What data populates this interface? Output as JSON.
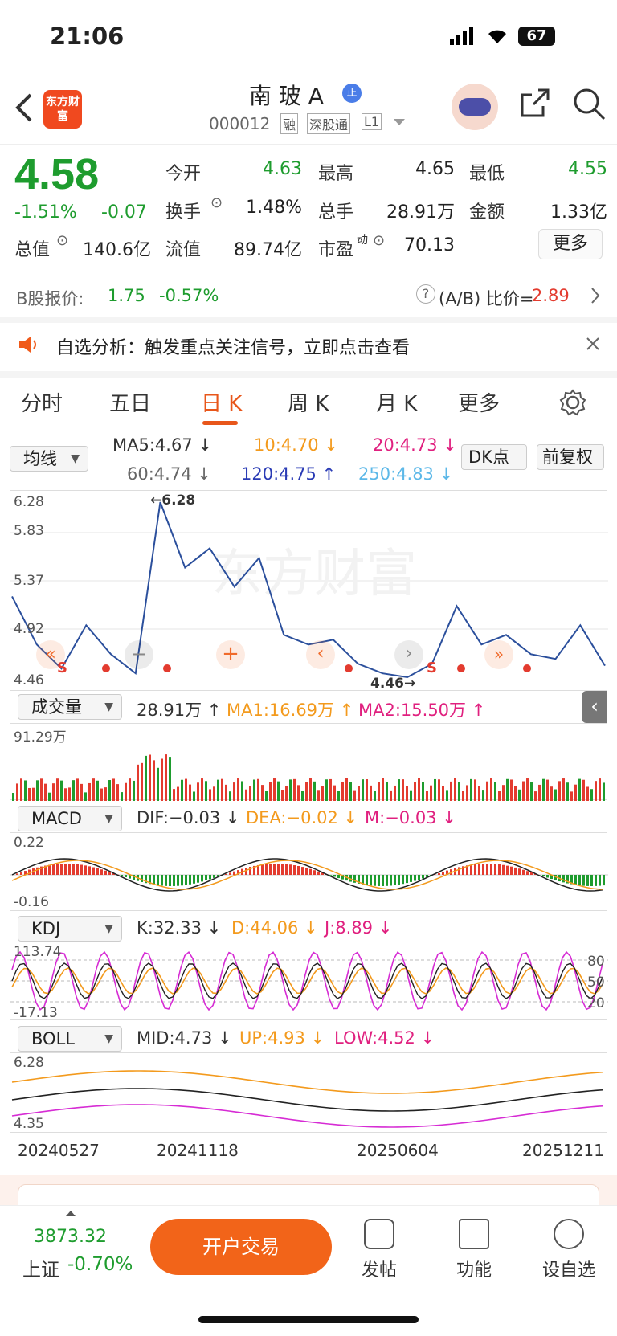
{
  "status": {
    "time": "21:06",
    "battery": "67"
  },
  "header": {
    "logo_text": "东方财富",
    "stock_name": "南 玻 A",
    "badge": "正",
    "code": "000012",
    "tags": [
      "融",
      "深股通",
      "L1"
    ]
  },
  "quote": {
    "price": "4.58",
    "change_pct": "-1.51%",
    "change": "-0.07",
    "open_label": "今开",
    "open": "4.63",
    "high_label": "最高",
    "high": "4.65",
    "low_label": "最低",
    "low": "4.55",
    "turnover_label": "换手",
    "turnover": "1.48%",
    "volume_label": "总手",
    "volume": "28.91万",
    "amount_label": "金额",
    "amount": "1.33亿",
    "mktcap_label": "总值",
    "mktcap": "140.6亿",
    "float_label": "流值",
    "float": "89.74亿",
    "pe_label": "市盈",
    "pe_sup": "动",
    "pe": "70.13",
    "more": "更多"
  },
  "bshare": {
    "label": "B股报价:",
    "price": "1.75",
    "change": "-0.57%",
    "ratio_label": "(A/B) 比价=",
    "ratio": "2.89"
  },
  "notice": {
    "text": "自选分析：触发重点关注信号，立即点击查看"
  },
  "tabs": [
    "分时",
    "五日",
    "日 K",
    "周 K",
    "月 K",
    "更多"
  ],
  "ma": {
    "select": "均线",
    "ma5": "MA5:4.67 ↓",
    "ma10": "10:4.70 ↓",
    "ma20": "20:4.73 ↓",
    "ma60": "60:4.74 ↓",
    "ma120": "120:4.75 ↑",
    "ma250": "250:4.83 ↓",
    "dk": "DK点",
    "fq": "前复权"
  },
  "price_axis": {
    "p1": "6.28",
    "p2": "5.83",
    "p3": "5.37",
    "p4": "4.92",
    "p5": "4.46",
    "max_mark": "←6.28",
    "min_mark": "4.46→"
  },
  "vol": {
    "select": "成交量",
    "v": "28.91万 ↑",
    "ma1": "MA1:16.69万 ↑",
    "ma2": "MA2:15.50万 ↑",
    "axis": "91.29万"
  },
  "macd": {
    "select": "MACD",
    "dif": "DIF:−0.03 ↓",
    "dea": "DEA:−0.02 ↓",
    "m": "M:−0.03 ↓",
    "top": "0.22",
    "bottom": "-0.16"
  },
  "kdj": {
    "select": "KDJ",
    "k": "K:32.33 ↓",
    "d": "D:44.06 ↓",
    "j": "J:8.89 ↓",
    "top": "113.74",
    "bottom": "-17.13",
    "r80": "80",
    "r50": "50",
    "r20": "20"
  },
  "boll": {
    "select": "BOLL",
    "mid": "MID:4.73 ↓",
    "up": "UP:4.93 ↓",
    "low": "LOW:4.52 ↓",
    "top": "6.28",
    "bottom": "4.35"
  },
  "dates": [
    "20240527",
    "20241118",
    "20250604",
    "20251211"
  ],
  "chart_data": {
    "type": "line",
    "title": "",
    "xlabel": "",
    "ylabel": "",
    "x": [
      "20240527",
      "20241118",
      "20250604",
      "20251211"
    ],
    "ylim": [
      4.46,
      6.28
    ],
    "series": [
      {
        "name": "",
        "values": [
          5.3,
          4.8,
          4.55,
          5.0,
          4.7,
          4.5,
          6.28,
          5.6,
          5.8,
          5.4,
          5.7,
          4.9,
          4.8,
          4.85,
          4.6,
          4.5,
          4.46,
          4.6,
          5.2,
          4.8,
          4.9,
          4.7,
          4.65,
          5.0,
          4.58
        ]
      }
    ]
  },
  "bottom": {
    "index_value": "3873.32",
    "index_name": "上证",
    "index_change": "-0.70%",
    "open_account": "开户交易",
    "post": "发帖",
    "func": "功能",
    "watch": "设自选"
  }
}
